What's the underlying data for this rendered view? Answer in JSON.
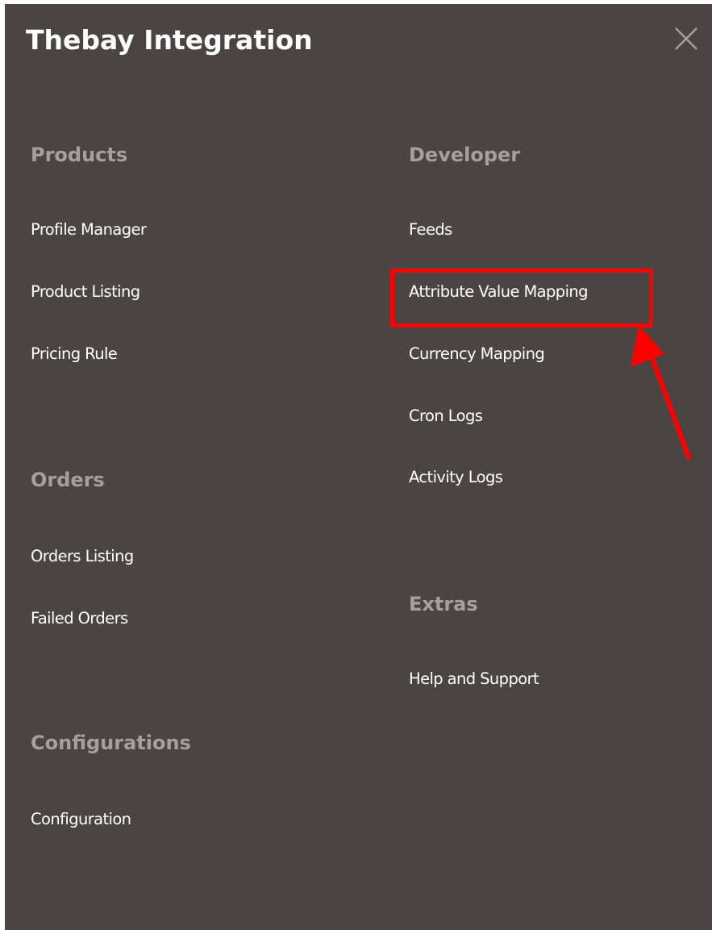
{
  "panel": {
    "title": "Thebay Integration",
    "close_icon": "close-icon"
  },
  "columns": {
    "left": {
      "sections": [
        {
          "title": "Products",
          "items": [
            "Profile Manager",
            "Product Listing",
            "Pricing Rule"
          ]
        },
        {
          "title": "Orders",
          "items": [
            "Orders Listing",
            "Failed Orders"
          ]
        },
        {
          "title": "Configurations",
          "items": [
            "Configuration"
          ]
        }
      ]
    },
    "right": {
      "sections": [
        {
          "title": "Developer",
          "items": [
            "Feeds",
            "Attribute Value Mapping",
            "Currency Mapping",
            "Cron Logs",
            "Activity Logs"
          ]
        },
        {
          "title": "Extras",
          "items": [
            "Help and Support"
          ]
        }
      ]
    }
  },
  "annotation": {
    "highlighted_item": "Attribute Value Mapping",
    "highlight_color": "#ff0000"
  },
  "colors": {
    "panel_background": "#4a4542",
    "section_title": "#a6a09c",
    "link": "#ffffff"
  }
}
